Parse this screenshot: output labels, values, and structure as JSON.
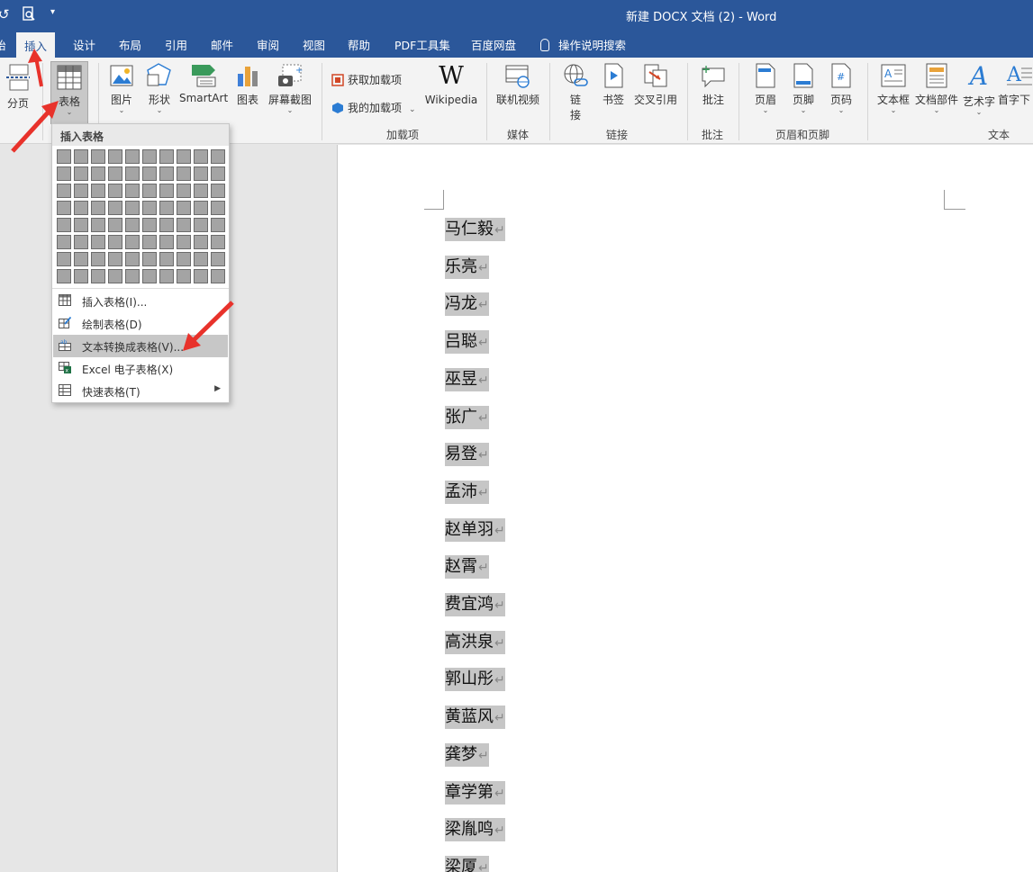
{
  "titlebar": {
    "title": "新建 DOCX 文档 (2)  -  Word"
  },
  "tabs": [
    {
      "label": "插入",
      "active": true
    },
    {
      "label": "设计"
    },
    {
      "label": "布局"
    },
    {
      "label": "引用"
    },
    {
      "label": "邮件"
    },
    {
      "label": "审阅"
    },
    {
      "label": "视图"
    },
    {
      "label": "帮助"
    },
    {
      "label": "PDF工具集"
    },
    {
      "label": "百度网盘"
    },
    {
      "label": "操作说明搜索"
    }
  ],
  "ribbon": {
    "page_break": "分页",
    "table": "表格",
    "picture": "图片",
    "shapes": "形状",
    "smartart": "SmartArt",
    "chart": "图表",
    "screenshot": "屏幕截图",
    "get_addins": "获取加载项",
    "my_addins": "我的加载项",
    "wikipedia": "Wikipedia",
    "online_video": "联机视频",
    "link_1": "链",
    "link_2": "接",
    "bookmark": "书签",
    "cross_ref": "交叉引用",
    "comment": "批注",
    "header": "页眉",
    "footer": "页脚",
    "page_number": "页码",
    "textbox": "文本框",
    "quick_parts": "文档部件",
    "wordart": "艺术字",
    "dropcap": "首字下",
    "groups": {
      "addins": "加载项",
      "media": "媒体",
      "links": "链接",
      "comments": "批注",
      "header_footer": "页眉和页脚",
      "text": "文本"
    }
  },
  "dropdown": {
    "header": "插入表格",
    "items": [
      {
        "label": "插入表格(I)..."
      },
      {
        "label": "绘制表格(D)"
      },
      {
        "label": "文本转换成表格(V)..."
      },
      {
        "label": "Excel 电子表格(X)"
      },
      {
        "label": "快速表格(T)"
      }
    ]
  },
  "document": {
    "names": [
      "马仁毅",
      "乐亮",
      "冯龙",
      "吕聪",
      "巫昱",
      "张广",
      "易登",
      "孟沛",
      "赵单羽",
      "赵霄",
      "费宜鸿",
      "高洪泉",
      "郭山彤",
      "黄蓝风",
      "龚梦",
      "章学第",
      "梁胤鸣",
      "梁厦"
    ],
    "paragraph_mark": "↵"
  },
  "colors": {
    "accent": "#2b579a",
    "selection": "#c6c6c6",
    "arrow": "#e8322b"
  }
}
